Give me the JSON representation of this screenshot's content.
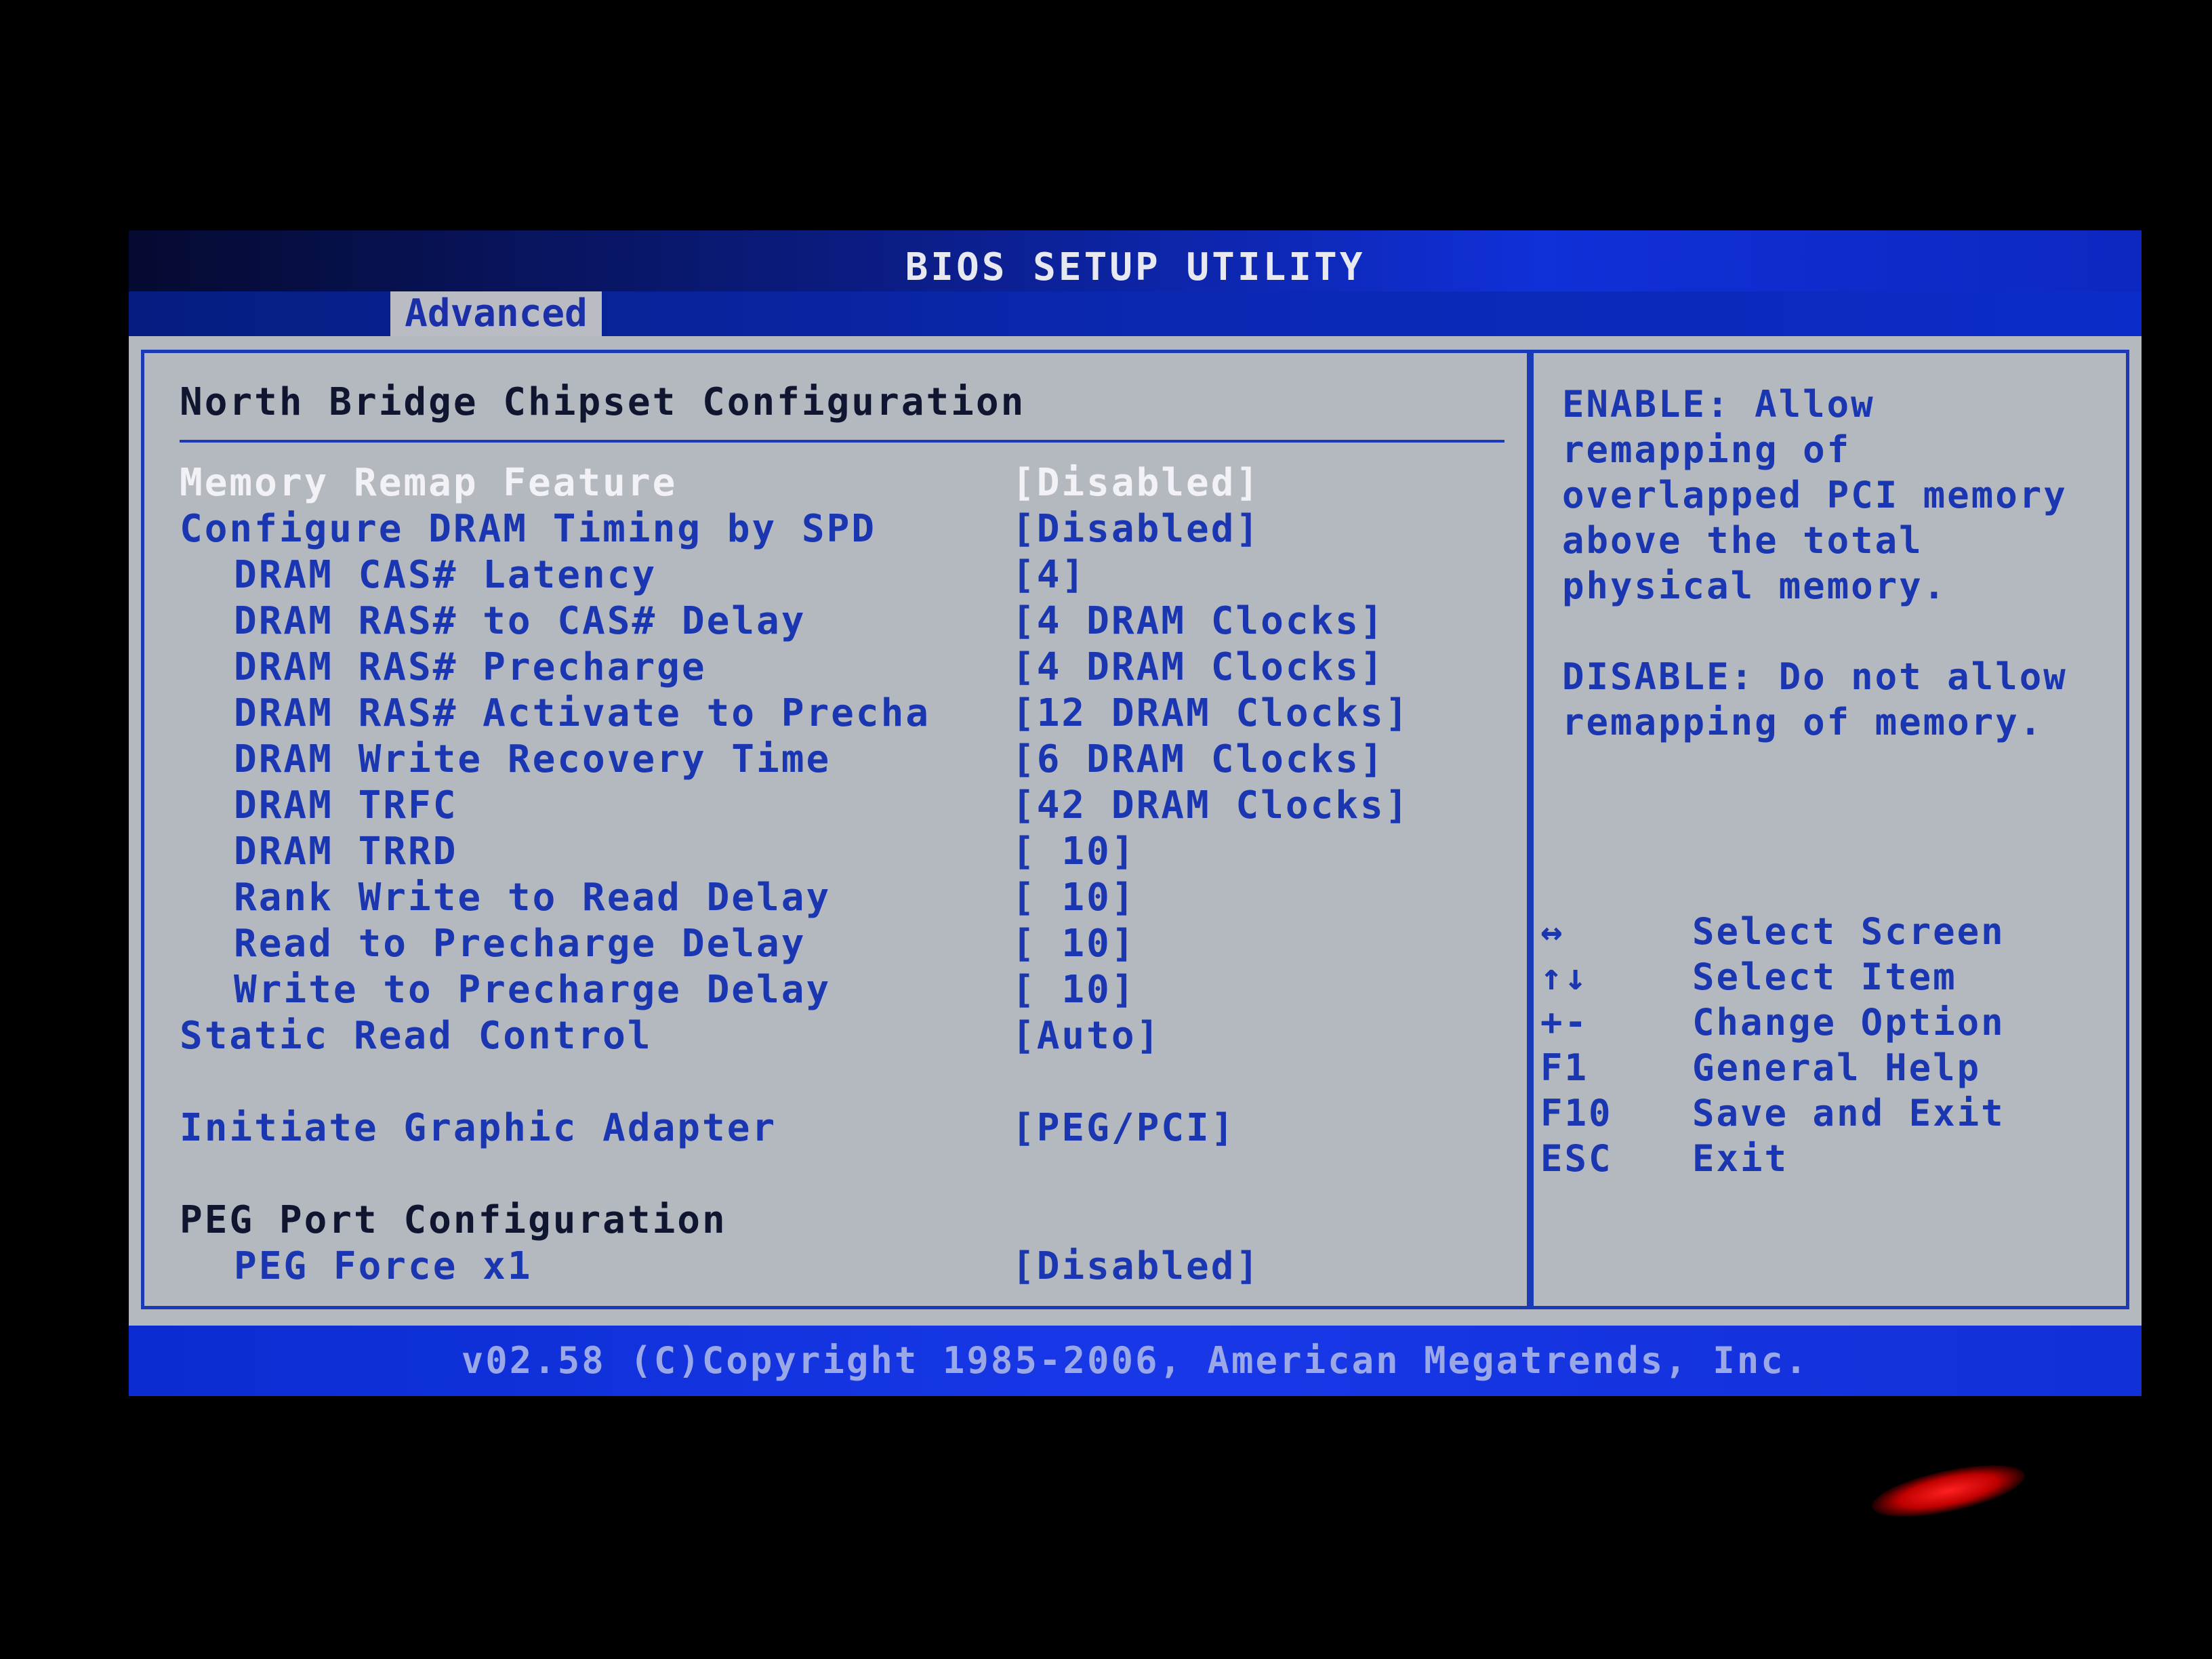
{
  "window": {
    "title": "BIOS SETUP UTILITY",
    "active_tab": "Advanced"
  },
  "section": {
    "title": "North Bridge Chipset Configuration"
  },
  "settings": [
    {
      "label": "Memory Remap Feature",
      "value": "[Disabled]",
      "level": 0,
      "selected": true
    },
    {
      "label": "Configure DRAM Timing by SPD",
      "value": "[Disabled]",
      "level": 0,
      "selected": false
    },
    {
      "label": "DRAM CAS# Latency",
      "value": "[4]",
      "level": 1,
      "selected": false
    },
    {
      "label": "DRAM RAS# to CAS# Delay",
      "value": "[4 DRAM Clocks]",
      "level": 1,
      "selected": false
    },
    {
      "label": "DRAM RAS# Precharge",
      "value": "[4 DRAM Clocks]",
      "level": 1,
      "selected": false
    },
    {
      "label": "DRAM RAS# Activate to Precha",
      "value": "[12 DRAM Clocks]",
      "level": 1,
      "selected": false
    },
    {
      "label": "DRAM Write Recovery Time",
      "value": "[6 DRAM Clocks]",
      "level": 1,
      "selected": false
    },
    {
      "label": "DRAM TRFC",
      "value": "[42 DRAM Clocks]",
      "level": 1,
      "selected": false
    },
    {
      "label": "DRAM TRRD",
      "value": "[ 10]",
      "level": 1,
      "selected": false
    },
    {
      "label": "Rank Write to Read Delay",
      "value": "[ 10]",
      "level": 1,
      "selected": false
    },
    {
      "label": "Read to Precharge Delay",
      "value": "[ 10]",
      "level": 1,
      "selected": false
    },
    {
      "label": "Write to Precharge Delay",
      "value": "[ 10]",
      "level": 1,
      "selected": false
    },
    {
      "label": "Static Read Control",
      "value": "[Auto]",
      "level": 0,
      "selected": false
    },
    {
      "label": "Initiate Graphic Adapter",
      "value": "[PEG/PCI]",
      "level": 0,
      "selected": false
    },
    {
      "label": "PEG Port Configuration",
      "value": "",
      "level": 0,
      "selected": false,
      "heading": true
    },
    {
      "label": "PEG Force x1",
      "value": "[Disabled]",
      "level": 1,
      "selected": false
    }
  ],
  "help": {
    "lines": [
      "ENABLE: Allow",
      "remapping of",
      "overlapped PCI memory",
      "above the total",
      "physical memory.",
      "",
      "DISABLE: Do not allow",
      "remapping of memory."
    ]
  },
  "keys": [
    {
      "key": "↔",
      "desc": "Select Screen"
    },
    {
      "key": "↑↓",
      "desc": "Select Item"
    },
    {
      "key": "+-",
      "desc": "Change Option"
    },
    {
      "key": "F1",
      "desc": "General Help"
    },
    {
      "key": "F10",
      "desc": "Save and Exit"
    },
    {
      "key": "ESC",
      "desc": "Exit"
    }
  ],
  "footer": {
    "text": "v02.58 (C)Copyright 1985-2006, American Megatrends, Inc."
  },
  "colors": {
    "panel_bg": "#b4b8bf",
    "text_blue": "#1a36b0",
    "selected_text": "#f2f2f6",
    "title_bar": "#0b1e8a",
    "footer_bar": "#1838e8"
  }
}
